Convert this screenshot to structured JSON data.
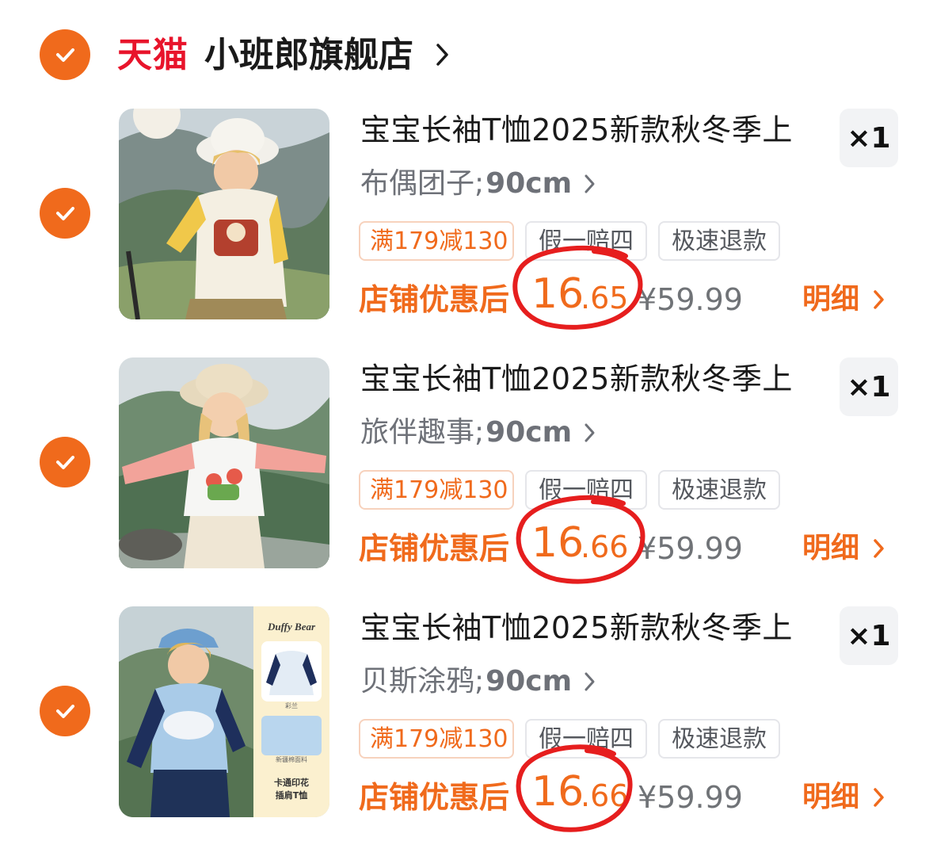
{
  "shop": {
    "platform": "天猫",
    "name": "小班郎旗舰店"
  },
  "items": [
    {
      "title": "宝宝长袖T恤2025新款秋冬季上",
      "variant_style": "布偶团子;",
      "variant_size": "90cm",
      "tags": [
        "满179减130",
        "假一赔四",
        "极速退款"
      ],
      "price_label": "店铺优惠后",
      "price_int": "16",
      "price_dec": ".65",
      "orig_price": "¥59.99",
      "detail_label": "明细",
      "qty": "×1",
      "image": "boy-in-bucket-hat-yellow-raglan-tee-mountain"
    },
    {
      "title": "宝宝长袖T恤2025新款秋冬季上",
      "variant_style": "旅伴趣事;",
      "variant_size": "90cm",
      "tags": [
        "满179减130",
        "假一赔四",
        "极速退款"
      ],
      "price_label": "店铺优惠后",
      "price_int": "16",
      "price_dec": ".66",
      "orig_price": "¥59.99",
      "detail_label": "明细",
      "qty": "×1",
      "image": "girl-in-bucket-hat-pink-raglan-tee-mountain"
    },
    {
      "title": "宝宝长袖T恤2025新款秋冬季上",
      "variant_style": "贝斯涂鸦;",
      "variant_size": "90cm",
      "tags": [
        "满179减130",
        "假一赔四",
        "极速退款"
      ],
      "price_label": "店铺优惠后",
      "price_int": "16",
      "price_dec": ".66",
      "orig_price": "¥59.99",
      "detail_label": "明细",
      "qty": "×1",
      "image": "boy-in-cap-blue-raglan-tee-with-product-panel",
      "side_panel": {
        "brand": "Duffy Bear",
        "caption_top": "彩兰",
        "caption_mid": "新疆棉面料",
        "caption_bottom_1": "卡通印花",
        "caption_bottom_2": "插肩T恤"
      }
    }
  ],
  "colors": {
    "accent": "#f06a1c",
    "tmall_red": "#e8142b",
    "annotation_red": "#e61e1e"
  },
  "icons": {
    "check": "check-icon",
    "chevron": "chevron-right-icon"
  }
}
